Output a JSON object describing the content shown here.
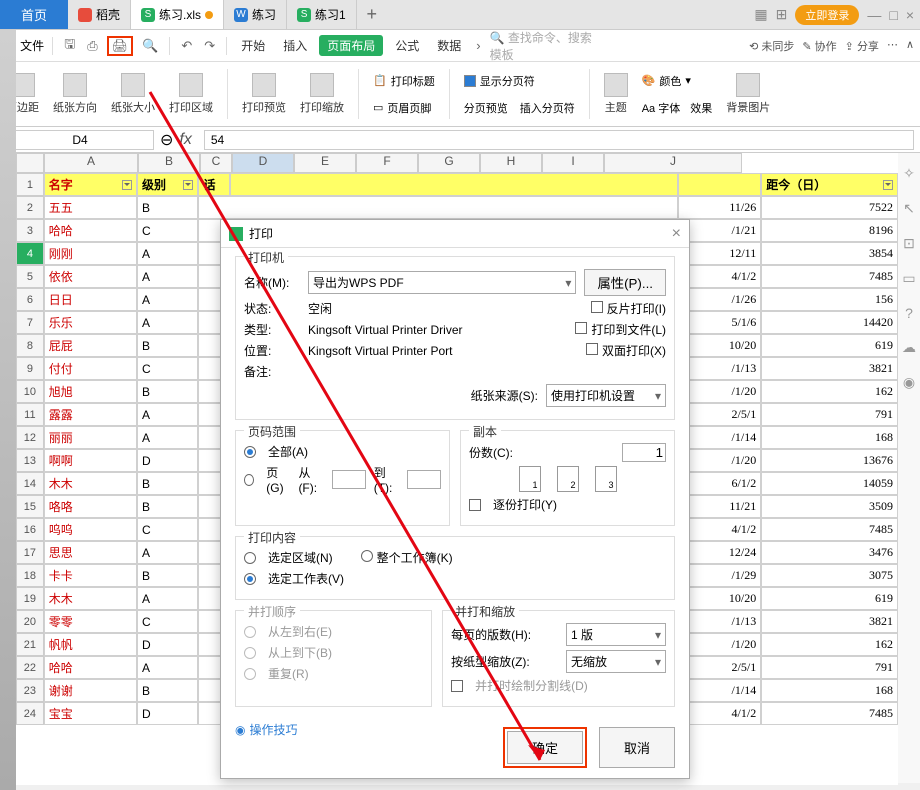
{
  "tabs": {
    "start": "首页",
    "daoq": "稻壳",
    "xls": "练习.xls",
    "doc": "练习",
    "xls2": "练习1",
    "login": "立即登录"
  },
  "toolbar": {
    "file": "文件",
    "menu": {
      "kaishi": "开始",
      "charu": "插入",
      "yemian": "页面布局",
      "gongshi": "公式",
      "shuju": "数据"
    },
    "search": "查找命令、搜索模板",
    "weitong": "未同步",
    "xiezuo": "协作",
    "fenxiang": "分享"
  },
  "ribbon": {
    "yebianju": "页边距",
    "zhizhang": "纸张方向",
    "zhida": "纸张大小",
    "dayinqu": "打印区域",
    "dayinyu": "打印预览",
    "dayinsuo": "打印缩放",
    "dayinbiaoti": "打印标题",
    "yemeiye": "页眉页脚",
    "xianshifen": "显示分页符",
    "fenyeyu": "分页预览",
    "charufen": "插入分页符",
    "zhuti": "主题",
    "yanse": "颜色",
    "ziti": "Aa 字体",
    "xiaoguo": "效果",
    "beijing": "背景图片"
  },
  "cell": {
    "ref": "D4",
    "val": "54"
  },
  "cols": {
    "A": "A",
    "B": "B",
    "C": "C",
    "D": "D",
    "E": "E",
    "F": "F",
    "G": "G",
    "H": "H",
    "I": "I",
    "J": "J"
  },
  "header_row": {
    "name": "名字",
    "level": "级别",
    "c": "话",
    "j": "距今（日）"
  },
  "rows": [
    {
      "n": "五五",
      "l": "B",
      "d": "11/26",
      "j": "7522"
    },
    {
      "n": "哈哈",
      "l": "C",
      "d": "/1/21",
      "j": "8196"
    },
    {
      "n": "刚刚",
      "l": "A",
      "d": "12/11",
      "j": "3854"
    },
    {
      "n": "依依",
      "l": "A",
      "d": "4/1/2",
      "j": "7485"
    },
    {
      "n": "日日",
      "l": "A",
      "d": "/1/26",
      "j": "156"
    },
    {
      "n": "乐乐",
      "l": "A",
      "d": "5/1/6",
      "j": "14420"
    },
    {
      "n": "屁屁",
      "l": "B",
      "d": "10/20",
      "j": "619"
    },
    {
      "n": "付付",
      "l": "C",
      "d": "/1/13",
      "j": "3821"
    },
    {
      "n": "旭旭",
      "l": "B",
      "d": "/1/20",
      "j": "162"
    },
    {
      "n": "露露",
      "l": "A",
      "d": "2/5/1",
      "j": "791"
    },
    {
      "n": "丽丽",
      "l": "A",
      "d": "/1/14",
      "j": "168"
    },
    {
      "n": "啊啊",
      "l": "D",
      "d": "/1/20",
      "j": "13676"
    },
    {
      "n": "木木",
      "l": "B",
      "d": "6/1/2",
      "j": "14059"
    },
    {
      "n": "咯咯",
      "l": "B",
      "d": "11/21",
      "j": "3509"
    },
    {
      "n": "呜呜",
      "l": "C",
      "d": "4/1/2",
      "j": "7485"
    },
    {
      "n": "思思",
      "l": "A",
      "d": "12/24",
      "j": "3476"
    },
    {
      "n": "卡卡",
      "l": "B",
      "d": "/1/29",
      "j": "3075"
    },
    {
      "n": "木木",
      "l": "A",
      "d": "10/20",
      "j": "619"
    },
    {
      "n": "零零",
      "l": "C",
      "d": "/1/13",
      "j": "3821"
    },
    {
      "n": "帆帆",
      "l": "D",
      "d": "/1/20",
      "j": "162"
    },
    {
      "n": "哈哈",
      "l": "A",
      "d": "2/5/1",
      "j": "791"
    },
    {
      "n": "谢谢",
      "l": "B",
      "d": "/1/14",
      "j": "168"
    },
    {
      "n": "宝宝",
      "l": "D",
      "d": "4/1/2",
      "j": "7485"
    }
  ],
  "dlg": {
    "title": "打印",
    "printer": "打印机",
    "name_lbl": "名称(M):",
    "name_val": "导出为WPS PDF",
    "props": "属性(P)...",
    "status_lbl": "状态:",
    "status_val": "空闲",
    "type_lbl": "类型:",
    "type_val": "Kingsoft Virtual Printer Driver",
    "where_lbl": "位置:",
    "where_val": "Kingsoft Virtual Printer Port",
    "comment_lbl": "备注:",
    "reverse": "反片打印(I)",
    "tofile": "打印到文件(L)",
    "duplex": "双面打印(X)",
    "source_lbl": "纸张来源(S):",
    "source_val": "使用打印机设置",
    "range": "页码范围",
    "all": "全部(A)",
    "pages": "页(G)",
    "from": "从(F):",
    "to": "到(T):",
    "copies": "副本",
    "copies_lbl": "份数(C):",
    "copies_val": "1",
    "collate": "逐份打印(Y)",
    "content": "打印内容",
    "sel_area": "选定区域(N)",
    "whole_wb": "整个工作簿(K)",
    "sel_sheet": "选定工作表(V)",
    "order": "并打顺序",
    "ltr": "从左到右(E)",
    "ttb": "从上到下(B)",
    "repeat": "重复(R)",
    "scale": "并打和缩放",
    "per_page": "每页的版数(H):",
    "per_page_val": "1 版",
    "by_paper": "按纸型缩放(Z):",
    "by_paper_val": "无缩放",
    "cutline": "并打时绘制分割线(D)",
    "tips": "操作技巧",
    "ok": "确定",
    "cancel": "取消"
  }
}
